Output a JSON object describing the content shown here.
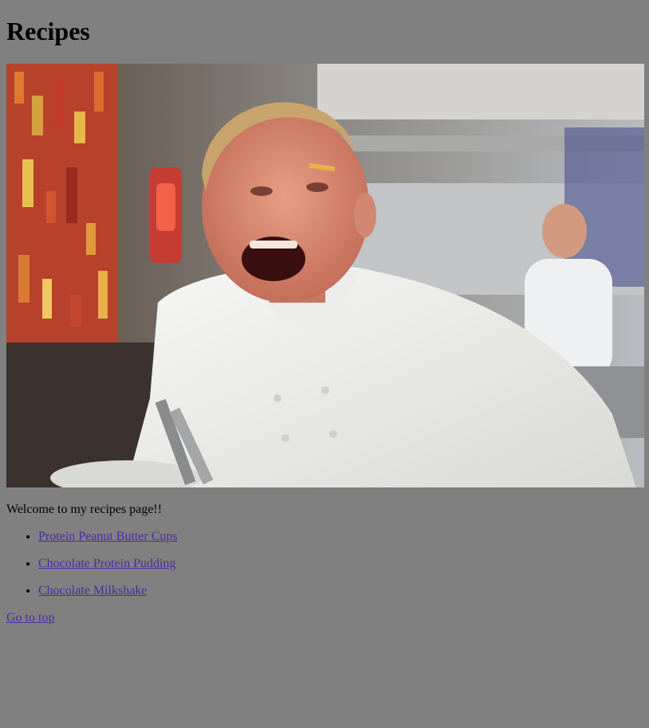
{
  "page": {
    "title": "Recipes",
    "image_alt": "Chef shouting in a restaurant kitchen",
    "intro": "Welcome to my recipes page!!",
    "recipes": [
      {
        "label": "Protein Peanut Butter Cups"
      },
      {
        "label": "Chocolate Protein Pudding"
      },
      {
        "label": "Chocolate Milkshake"
      }
    ],
    "top_link": "Go to top"
  },
  "colors": {
    "background": "#808080",
    "link": "#4b2ba8"
  }
}
